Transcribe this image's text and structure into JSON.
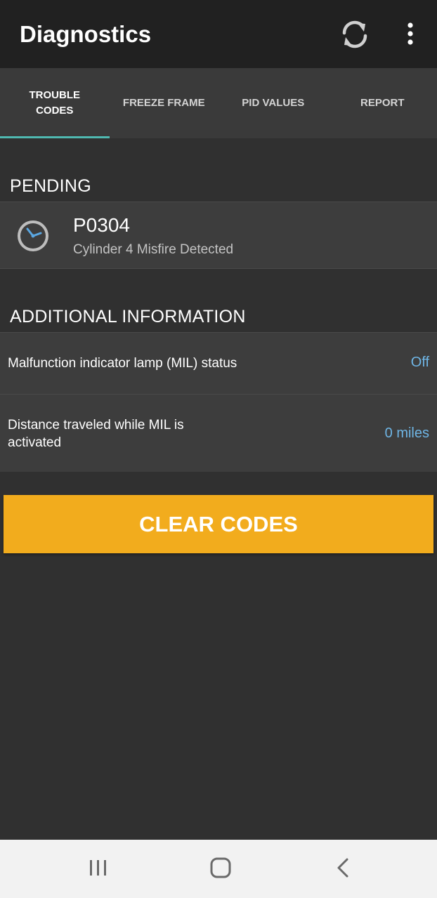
{
  "app_bar": {
    "title": "Diagnostics",
    "icons": [
      "refresh-icon",
      "more-vertical-icon"
    ]
  },
  "tabs": [
    {
      "label": "TROUBLE\nCODES",
      "active": true
    },
    {
      "label": "FREEZE FRAME",
      "active": false
    },
    {
      "label": "PID VALUES",
      "active": false
    },
    {
      "label": "REPORT",
      "active": false
    }
  ],
  "pending": {
    "header": "PENDING",
    "codes": [
      {
        "code": "P0304",
        "description": "Cylinder 4 Misfire Detected",
        "icon": "clock-icon"
      }
    ]
  },
  "additional": {
    "header": "ADDITIONAL INFORMATION",
    "rows": [
      {
        "label": "Malfunction indicator lamp (MIL) status",
        "value": "Off"
      },
      {
        "label": "Distance traveled while MIL is activated",
        "value": "0 miles"
      }
    ]
  },
  "actions": {
    "clear_label": "CLEAR CODES"
  },
  "nav": {
    "icons": [
      "recents-icon",
      "home-icon",
      "back-icon"
    ]
  },
  "colors": {
    "accent": "#4fb9b1",
    "button": "#f2ac1d",
    "value_text": "#6fb6e6",
    "background": "#303030"
  }
}
